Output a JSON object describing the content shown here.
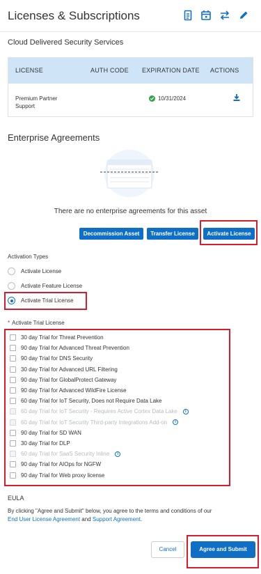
{
  "header": {
    "title": "Licenses & Subscriptions",
    "icons": [
      "document-icon",
      "calendar-icon",
      "transfer-icon",
      "edit-icon"
    ]
  },
  "cloud_services": {
    "subtitle": "Cloud Delivered Security Services",
    "columns": [
      "LICENSE",
      "AUTH CODE",
      "EXPIRATION DATE",
      "ACTIONS"
    ],
    "rows": [
      {
        "license": "Premium Partner Support",
        "auth_code": "",
        "expiration": "10/31/2024",
        "status": "active"
      }
    ]
  },
  "enterprise": {
    "title": "Enterprise Agreements",
    "empty_text": "There are no enterprise agreements for this asset",
    "buttons": {
      "decommission": "Decommission Asset",
      "transfer": "Transfer License",
      "activate": "Activate License"
    }
  },
  "activation": {
    "label": "Activation Types",
    "options": [
      {
        "label": "Activate License",
        "selected": false
      },
      {
        "label": "Activate Feature License",
        "selected": false
      },
      {
        "label": "Activate Trial License",
        "selected": true
      }
    ]
  },
  "trial": {
    "required_mark": "*",
    "label": "Activate Trial License",
    "items": [
      {
        "label": "30 day Trial for Threat Prevention",
        "disabled": false,
        "info": false
      },
      {
        "label": "90 day Trial for Advanced Threat Prevention",
        "disabled": false,
        "info": false
      },
      {
        "label": "90 day Trial for DNS Security",
        "disabled": false,
        "info": false
      },
      {
        "label": "30 day Trial for Advanced URL Filtering",
        "disabled": false,
        "info": false
      },
      {
        "label": "90 day Trial for GlobalProtect Gateway",
        "disabled": false,
        "info": false
      },
      {
        "label": "90 day Trial for Advanced WildFire License",
        "disabled": false,
        "info": false
      },
      {
        "label": "60 day Trial for IoT Security, Does not Require Data Lake",
        "disabled": false,
        "info": false
      },
      {
        "label": "60 day Trial for IoT Security - Requires Active Cortex Data Lake",
        "disabled": true,
        "info": true
      },
      {
        "label": "60 day Trial for IoT Security Third-party Integrations Add-on",
        "disabled": true,
        "info": true
      },
      {
        "label": "90 day Trial for SD WAN",
        "disabled": false,
        "info": false
      },
      {
        "label": "30 day Trial for DLP",
        "disabled": false,
        "info": false
      },
      {
        "label": "60 day Trial for SaaS Security Inline",
        "disabled": true,
        "info": true
      },
      {
        "label": "90 day Trial for AIOps for NGFW",
        "disabled": false,
        "info": false
      },
      {
        "label": "90 day Trial for Web proxy license",
        "disabled": false,
        "info": false
      }
    ]
  },
  "eula": {
    "heading": "EULA",
    "text_before": "By clicking \"Agree and Submit\" below, you agree to the terms and conditions of our",
    "link1": "End User License Agreement",
    "and": "and",
    "link2": "Support Agreement",
    "text_after": "."
  },
  "footer": {
    "cancel": "Cancel",
    "submit": "Agree and Submit"
  },
  "colors": {
    "accent": "#0f6fc6",
    "highlight": "#d81b2d",
    "table_header": "#cfe5f7",
    "success": "#35a24a"
  }
}
